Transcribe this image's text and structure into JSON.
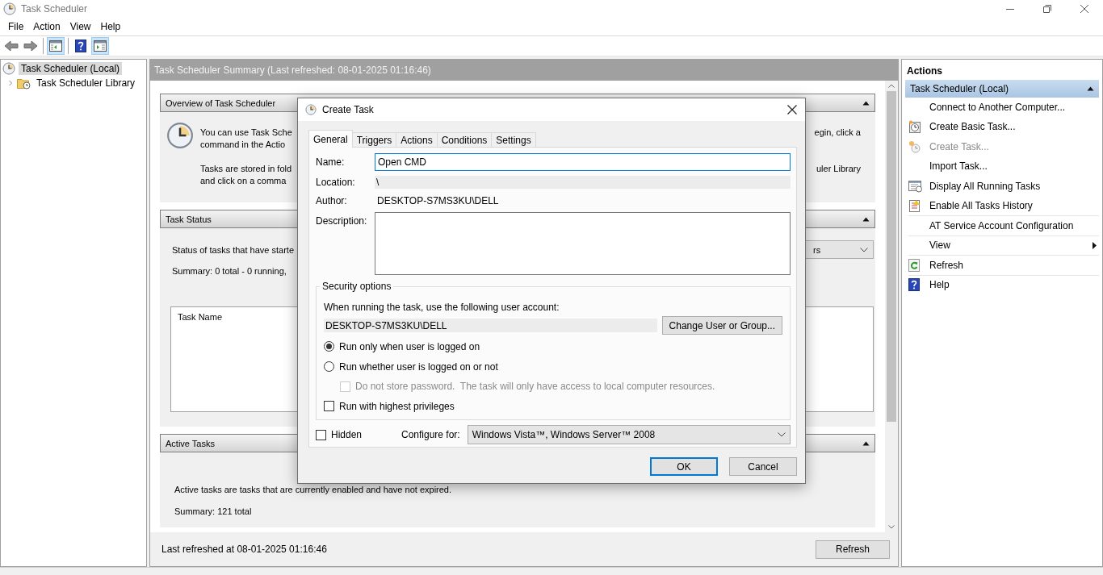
{
  "window": {
    "title": "Task Scheduler"
  },
  "menu": [
    "File",
    "Action",
    "View",
    "Help"
  ],
  "toolbar": [
    {
      "kind": "back",
      "pressed": false
    },
    {
      "kind": "forward",
      "pressed": false
    },
    {
      "kind": "console-tree",
      "pressed": true
    },
    {
      "kind": "help",
      "pressed": false
    },
    {
      "kind": "action-pane",
      "pressed": true
    }
  ],
  "tree": [
    {
      "label": "Task Scheduler (Local)",
      "selected": true,
      "children": [
        {
          "label": "Task Scheduler Library",
          "selected": false,
          "expanded": false
        }
      ]
    }
  ],
  "summary": {
    "header": "Task Scheduler Summary (Last refreshed: 08-01-2025 01:16:46)",
    "sections": [
      {
        "kind": "overview",
        "title": "Overview of Task Scheduler",
        "expanded": true,
        "lines": [
          {
            "left": "You can use Task Sche",
            "right": "egin, click a"
          },
          {
            "left": "command in the Actio"
          },
          {
            "left": "Tasks are stored in fold",
            "right": "uler Library"
          },
          {
            "left": "and click on a comma"
          }
        ]
      },
      {
        "kind": "status",
        "title": "Task Status",
        "expanded": true,
        "status_text": "Status of tasks that have starte",
        "period": "rs",
        "summary": "Summary: 0 total - 0 running,",
        "column": "Task Name"
      },
      {
        "kind": "active",
        "title": "Active Tasks",
        "expanded": true,
        "description": "Active tasks are tasks that are currently enabled and have not expired.",
        "summary": "Summary: 121 total"
      }
    ],
    "footer": "Last refreshed at 08-01-2025 01:16:46",
    "refresh": "Refresh"
  },
  "actions": {
    "title": "Actions",
    "group": {
      "label": "Task Scheduler (Local)",
      "expanded": true
    },
    "items": [
      {
        "label": "Connect to Another Computer...",
        "kind": "none",
        "disabled": false,
        "divider": false
      },
      {
        "label": "Create Basic Task...",
        "kind": "wizard",
        "disabled": false,
        "divider": false
      },
      {
        "label": "Create Task...",
        "kind": "new-task",
        "disabled": true,
        "divider": false
      },
      {
        "label": "Import Task...",
        "kind": "none",
        "disabled": false,
        "divider": false
      },
      {
        "label": "Display All Running Tasks",
        "kind": "running",
        "disabled": false,
        "divider": false
      },
      {
        "label": "Enable All Tasks History",
        "kind": "history",
        "disabled": false,
        "divider": true
      },
      {
        "label": "AT Service Account Configuration",
        "kind": "none",
        "disabled": false,
        "divider": true
      },
      {
        "label": "View",
        "kind": "none",
        "disabled": false,
        "divider": true,
        "submenu": true
      },
      {
        "label": "Refresh",
        "kind": "refresh",
        "disabled": false,
        "divider": true
      },
      {
        "label": "Help",
        "kind": "help",
        "disabled": false,
        "divider": false
      }
    ]
  },
  "dialog": {
    "title": "Create Task",
    "tabs": [
      {
        "label": "General",
        "selected": true
      },
      {
        "label": "Triggers",
        "selected": false
      },
      {
        "label": "Actions",
        "selected": false
      },
      {
        "label": "Conditions",
        "selected": false
      },
      {
        "label": "Settings",
        "selected": false
      }
    ],
    "name_label": "Name:",
    "name": "Open CMD",
    "location_label": "Location:",
    "location": "\\",
    "author_label": "Author:",
    "author": "DESKTOP-S7MS3KU\\DELL",
    "description_label": "Description:",
    "security": {
      "title": "Security options",
      "prompt": "When running the task, use the following user account:",
      "account": "DESKTOP-S7MS3KU\\DELL",
      "change_button": "Change User or Group...",
      "options": [
        {
          "kind": "radio",
          "label": "Run only when user is logged on",
          "checked": true,
          "disabled": false
        },
        {
          "kind": "radio",
          "label": "Run whether user is logged on or not",
          "checked": false,
          "disabled": false,
          "children": [
            {
              "kind": "checkbox",
              "label": "Do not store password.  The task will only have access to local computer resources.",
              "checked": false,
              "disabled": true
            }
          ]
        },
        {
          "kind": "checkbox",
          "label": "Run with highest privileges",
          "checked": false,
          "disabled": false
        }
      ]
    },
    "hidden": {
      "label": "Hidden",
      "checked": false
    },
    "configure_label": "Configure for:",
    "configure": "Windows Vista™, Windows Server™ 2008",
    "buttons": [
      {
        "label": "OK",
        "default": true
      },
      {
        "label": "Cancel",
        "default": false
      }
    ]
  }
}
